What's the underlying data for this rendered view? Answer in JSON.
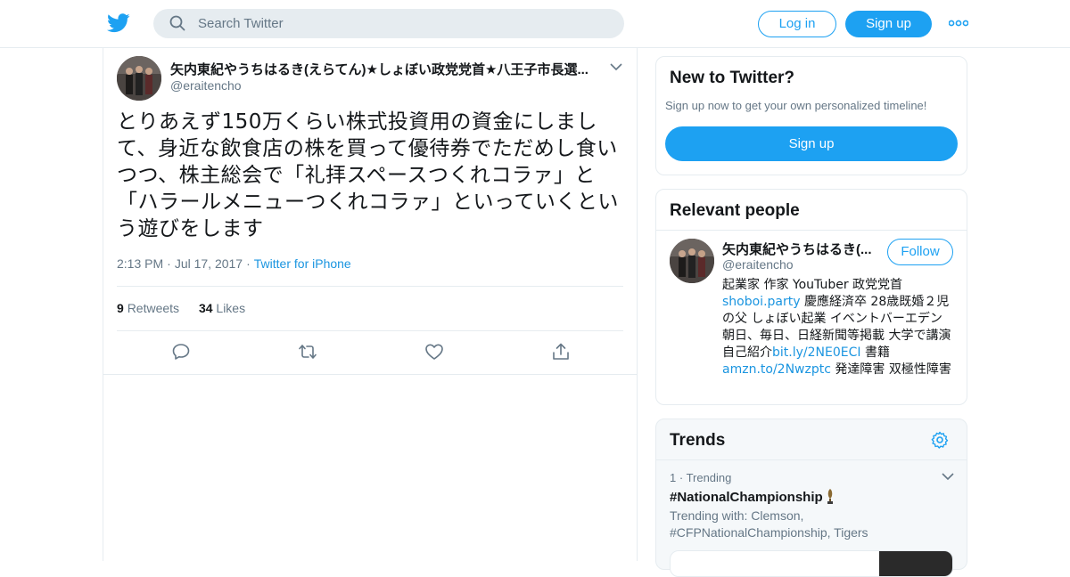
{
  "header": {
    "search_placeholder": "Search Twitter",
    "login_label": "Log in",
    "signup_label": "Sign up",
    "brand_color": "#1da1f2"
  },
  "tweet": {
    "author_name": "矢内東紀やうちはるき(えらてん)★しょぼい政党党首★八王子市長選...",
    "author_handle": "@eraitencho",
    "text": "とりあえず150万くらい株式投資用の資金にしまして、身近な飲食店の株を買って優待券でただめし食いつつ、株主総会で「礼拝スペースつくれコラァ」と「ハラールメニューつくれコラァ」といっていくという遊びをします",
    "time": "2:13 PM",
    "date": "Jul 17, 2017",
    "source": "Twitter for iPhone",
    "retweets_count": "9",
    "retweets_label": "Retweets",
    "likes_count": "34",
    "likes_label": "Likes"
  },
  "new_to_twitter": {
    "title": "New to Twitter?",
    "subtitle": "Sign up now to get your own personalized timeline!",
    "signup_label": "Sign up"
  },
  "relevant_people": {
    "title": "Relevant people",
    "name": "矢内東紀やうちはるき(...",
    "handle": "@eraitencho",
    "follow_label": "Follow",
    "bio_1": "起業家 作家 YouTuber 政党党首",
    "bio_link_1": "shoboi.party",
    "bio_2": " 慶應経済卒 28歳既婚２児の父 しょぼい起業 イベントバーエデン朝日、毎日、日経新聞等掲載 大学で講演 自己紹介",
    "bio_link_2": "bit.ly/2NE0ECI",
    "bio_3": " 書籍",
    "bio_link_3": "amzn.to/2Nwzptc",
    "bio_4": " 発達障害 双極性障害"
  },
  "trends": {
    "title": "Trends",
    "rank": "1",
    "rank_label": "Trending",
    "name": "#NationalChampionship",
    "with": "Trending with: Clemson, #CFPNationalChampionship, Tigers"
  }
}
